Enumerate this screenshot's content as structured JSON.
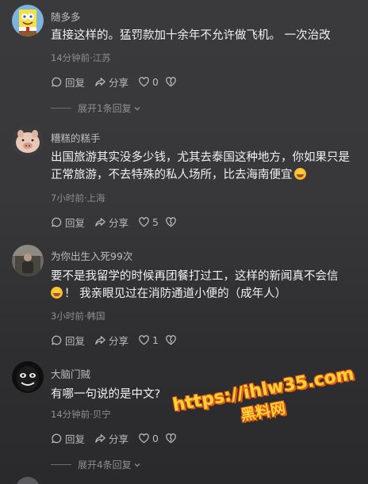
{
  "comments": [
    {
      "username": "随多多",
      "lines": [
        "直接这样的。猛罚款加十余年不允许做飞机。 一次治改"
      ],
      "time": "14分钟前",
      "location": "江苏",
      "reply_label": "回复",
      "share_label": "分享",
      "likes": "0",
      "expand": "展开1条回复"
    },
    {
      "username": "糟糕的糕手",
      "lines": [
        "出国旅游其实没多少钱，尤其去泰国这种地方，你如果只是",
        "正常旅游，不去特殊的私人场所，比去海南便宜"
      ],
      "time": "7小时前",
      "location": "上海",
      "reply_label": "回复",
      "share_label": "分享",
      "likes": "5"
    },
    {
      "username": "为你出生入死99次",
      "lines": [
        "要不是我留学的时候再团餐打过工，这样的新闻真不会信",
        "！ 我亲眼见过在消防通道小便的（成年人）"
      ],
      "time": "3小时前",
      "location": "韩国",
      "reply_label": "回复",
      "share_label": "分享",
      "likes": "1"
    },
    {
      "username": "大脑门贼",
      "lines": [
        "有哪一句说的是中文?"
      ],
      "time": "14分钟前",
      "location": "贝宁",
      "reply_label": "回复",
      "share_label": "分享",
      "likes": "0",
      "expand": "展开4条回复"
    }
  ],
  "meta_separator": "·",
  "watermark": {
    "url": "https://ihlw35.com",
    "name": "黑料网"
  },
  "colors": {
    "background": "#38383a",
    "text": "#f0f0f0",
    "muted": "#8e8e93",
    "watermark": "#ffd23a",
    "watermark_outline": "#e25b12"
  }
}
